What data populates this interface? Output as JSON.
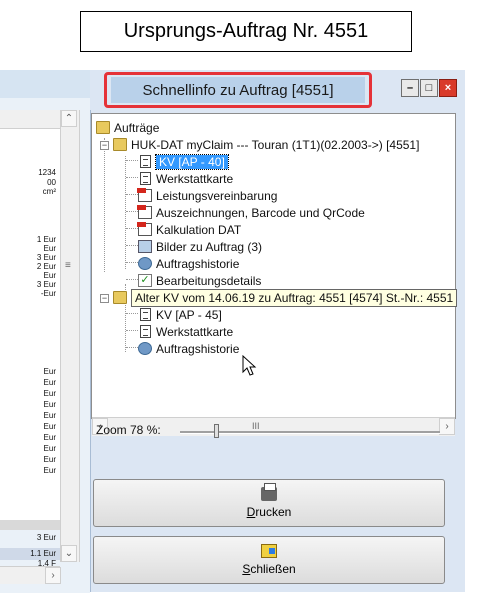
{
  "caption": "Ursprungs-Auftrag Nr. 4551",
  "window": {
    "title": "Schnellinfo zu Auftrag [4551]",
    "controls": {
      "minimize": "–",
      "maximize": "□",
      "close": "×"
    }
  },
  "background_window": {
    "top_values": [
      "1234",
      "00",
      "cm²"
    ],
    "values_a": [
      "1 Eur",
      "Eur",
      "3 Eur",
      "2 Eur",
      "Eur",
      "3 Eur",
      "-Eur"
    ],
    "values_b": [
      "Eur",
      "Eur",
      "Eur",
      "Eur",
      "Eur",
      "Eur",
      "Eur",
      "Eur",
      "Eur",
      "Eur"
    ],
    "values_c": [
      "3 Eur",
      "1.1 Eur",
      "1.4 F"
    ]
  },
  "tree": {
    "root": "Aufträge",
    "order1": {
      "label": "HUK-DAT myClaim  --- Touran (1T1)(02.2003->) [4551]",
      "items": [
        {
          "label": "KV [AP - 40]",
          "icon": "document-icon"
        },
        {
          "label": "Werkstattkarte",
          "icon": "document-icon"
        },
        {
          "label": "Leistungsvereinbarung",
          "icon": "pdf-icon"
        },
        {
          "label": "Auszeichnungen, Barcode und QrCode",
          "icon": "pdf-icon"
        },
        {
          "label": "Kalkulation DAT",
          "icon": "pdf-icon"
        },
        {
          "label": "Bilder zu Auftrag (3)",
          "icon": "images-icon"
        },
        {
          "label": "Auftragshistorie",
          "icon": "history-icon"
        },
        {
          "label": "Bearbeitungsdetails",
          "icon": "checkmark-icon"
        }
      ]
    },
    "order2": {
      "label": "Alter KV vom 14.06.19 zu Auftrag: 4551 [4574] St.-Nr.: 4551",
      "items": [
        {
          "label": "KV [AP - 45]",
          "icon": "document-icon"
        },
        {
          "label": "Werkstattkarte",
          "icon": "document-icon"
        },
        {
          "label": "Auftragshistorie",
          "icon": "history-icon"
        }
      ]
    },
    "hscroll_grip": "III"
  },
  "zoom": {
    "label": "Zoom 78 %:",
    "value_percent": 78
  },
  "buttons": {
    "print_underlined": "D",
    "print_rest": "rucken",
    "close_underlined": "S",
    "close_rest": "chließen"
  }
}
